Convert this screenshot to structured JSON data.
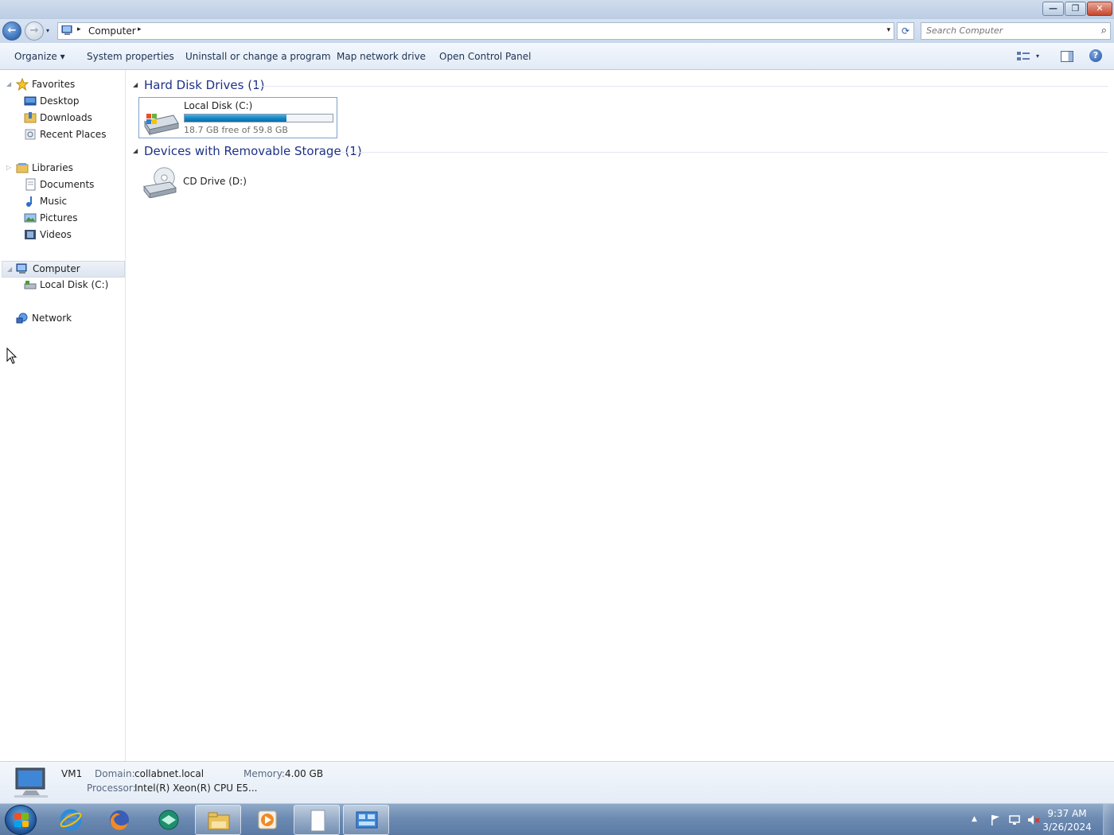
{
  "window": {
    "minimize_glyph": "—",
    "maximize_glyph": "❐",
    "close_glyph": "✕"
  },
  "address": {
    "back_glyph": "←",
    "forward_glyph": "→",
    "path": "Computer",
    "separator": "▸",
    "dropdown_glyph": "▾",
    "refresh_glyph": "⟳",
    "icon": "computer-icon"
  },
  "search": {
    "placeholder": "Search Computer",
    "icon": "search-icon",
    "icon_glyph": "⌕"
  },
  "toolbar": {
    "organize": "Organize ▾",
    "system_properties": "System properties",
    "uninstall": "Uninstall or change a program",
    "map_drive": "Map network drive",
    "control_panel": "Open Control Panel",
    "view_dd": "▾",
    "help": "?"
  },
  "sidebar": {
    "favorites": {
      "label": "Favorites",
      "items": [
        {
          "label": "Desktop",
          "icon": "desktop-icon"
        },
        {
          "label": "Downloads",
          "icon": "downloads-folder-icon"
        },
        {
          "label": "Recent Places",
          "icon": "recent-places-icon"
        }
      ]
    },
    "libraries": {
      "label": "Libraries",
      "items": [
        {
          "label": "Documents",
          "icon": "documents-icon"
        },
        {
          "label": "Music",
          "icon": "music-icon"
        },
        {
          "label": "Pictures",
          "icon": "pictures-icon"
        },
        {
          "label": "Videos",
          "icon": "videos-icon"
        }
      ]
    },
    "computer": {
      "label": "Computer",
      "items": [
        {
          "label": "Local Disk (C:)",
          "icon": "hard-disk-icon"
        }
      ]
    },
    "network": {
      "label": "Network"
    },
    "expand_glyph": "◢",
    "collapsed_glyph": "▷"
  },
  "content": {
    "groups": [
      {
        "title": "Hard Disk Drives (1)",
        "toggle": "◢",
        "drives": [
          {
            "name": "Local Disk (C:)",
            "free_text": "18.7 GB free of 59.8 GB",
            "used_fraction": 0.687,
            "icon": "hard-disk-icon"
          }
        ]
      },
      {
        "title": "Devices with Removable Storage (1)",
        "toggle": "◢",
        "drives": [
          {
            "name": "CD Drive (D:)",
            "icon": "cd-drive-icon"
          }
        ]
      }
    ]
  },
  "details": {
    "name": "VM1",
    "domain_label": "Domain:",
    "domain": "collabnet.local",
    "memory_label": "Memory:",
    "memory": "4.00 GB",
    "processor_label": "Processor:",
    "processor": "Intel(R) Xeon(R) CPU E5..."
  },
  "taskbar": {
    "apps": [
      {
        "name": "internet-explorer-icon"
      },
      {
        "name": "firefox-icon"
      },
      {
        "name": "app-globe-icon"
      },
      {
        "name": "file-explorer-icon",
        "active": true
      },
      {
        "name": "media-player-icon"
      },
      {
        "name": "notepad-icon"
      },
      {
        "name": "control-panel-icon"
      }
    ],
    "tray_up": "▲",
    "time": "9:37 AM",
    "date": "3/26/2024"
  },
  "colors": {
    "accent": "#1e3287",
    "disk_fill": "#1688c4",
    "taskbar": "#6d8bb2"
  }
}
